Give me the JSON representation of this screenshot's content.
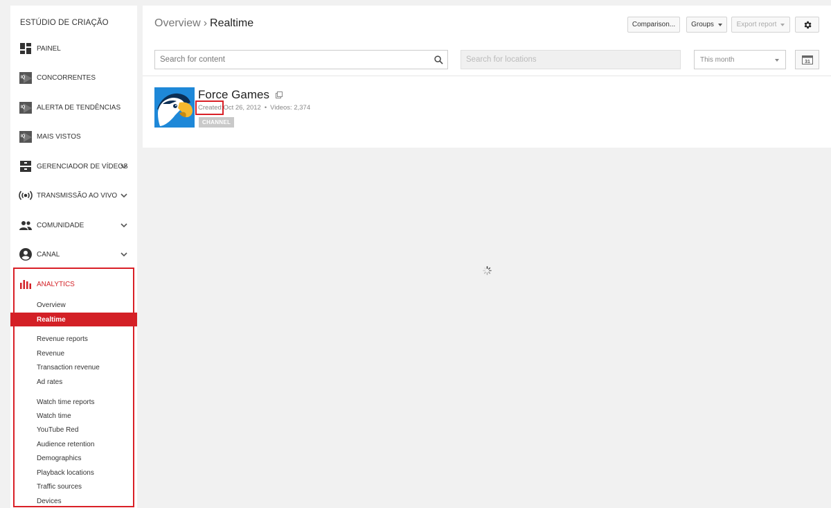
{
  "sidebar": {
    "title": "ESTÚDIO DE CRIAÇÃO",
    "nav": [
      {
        "label": "PAINEL",
        "icon": "dashboard-icon"
      },
      {
        "label": "CONCORRENTES",
        "icon": "channel-icon"
      },
      {
        "label": "ALERTA DE TENDÊNCIAS",
        "icon": "channel-icon"
      },
      {
        "label": "MAIS VISTOS",
        "icon": "channel-icon"
      },
      {
        "label": "GERENCIADOR DE VÍDEOS",
        "icon": "video-manager-icon"
      },
      {
        "label": "TRANSMISSÃO AO VIVO",
        "icon": "live-broadcast-icon"
      },
      {
        "label": "COMUNIDADE",
        "icon": "community-icon"
      },
      {
        "label": "CANAL",
        "icon": "account-icon"
      },
      {
        "label": "ANALYTICS",
        "icon": "analytics-icon"
      }
    ],
    "analytics_items": [
      "Overview",
      "Realtime",
      "Revenue reports",
      "Revenue",
      "Transaction revenue",
      "Ad rates",
      "Watch time reports",
      "Watch time",
      "YouTube Red",
      "Audience retention",
      "Demographics",
      "Playback locations",
      "Traffic sources",
      "Devices"
    ],
    "active_item": "Realtime",
    "accent_color": "#d32026"
  },
  "header": {
    "breadcrumb_parent": "Overview",
    "breadcrumb_separator": "›",
    "breadcrumb_current": "Realtime",
    "comparison_label": "Comparison...",
    "groups_label": "Groups",
    "export_label": "Export report",
    "settings_icon": "gear-icon"
  },
  "filters": {
    "content_placeholder": "Search for content",
    "location_placeholder": "Search for locations",
    "date_range": "This month",
    "calendar_day": "31"
  },
  "channel": {
    "name": "Force Games",
    "created_label": "Created:",
    "created_date": "Oct 26, 2012",
    "videos_label": "Videos:",
    "videos_count": "2,374",
    "separator": "•",
    "badge": "CHANNEL"
  }
}
